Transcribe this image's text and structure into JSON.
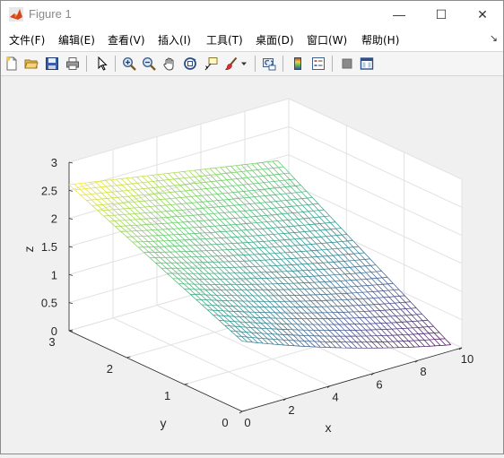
{
  "window": {
    "title": "Figure 1",
    "controls": {
      "minimize": "—",
      "maximize": "☐",
      "close": "✕"
    }
  },
  "menubar": {
    "items": [
      "文件(F)",
      "编辑(E)",
      "查看(V)",
      "插入(I)",
      "工具(T)",
      "桌面(D)",
      "窗口(W)",
      "帮助(H)"
    ],
    "overflow_icon": "arrow-icon"
  },
  "toolbar": {
    "buttons": [
      {
        "name": "new-figure-icon"
      },
      {
        "name": "open-file-icon"
      },
      {
        "name": "save-icon"
      },
      {
        "name": "print-icon"
      },
      {
        "name": "pointer-icon"
      },
      {
        "name": "zoom-in-icon"
      },
      {
        "name": "zoom-out-icon"
      },
      {
        "name": "pan-hand-icon"
      },
      {
        "name": "rotate-3d-icon"
      },
      {
        "name": "data-cursor-icon"
      },
      {
        "name": "brush-icon"
      },
      {
        "name": "link-plot-icon"
      },
      {
        "name": "colorbar-icon"
      },
      {
        "name": "legend-icon"
      },
      {
        "name": "hide-plot-tools-icon"
      },
      {
        "name": "show-plot-tools-icon"
      }
    ]
  },
  "chart_data": {
    "type": "surface-mesh",
    "title": "",
    "xlabel": "x",
    "ylabel": "y",
    "zlabel": "z",
    "xlim": [
      0,
      10
    ],
    "ylim": [
      0,
      3
    ],
    "zlim": [
      0,
      3
    ],
    "xticks": [
      "0",
      "2",
      "4",
      "6",
      "8",
      "10"
    ],
    "yticks": [
      "0",
      "1",
      "2",
      "3"
    ],
    "zticks": [
      "0",
      "0.5",
      "1",
      "1.5",
      "2",
      "2.5",
      "3"
    ],
    "x_range": [
      0,
      9.5
    ],
    "y_range": [
      0,
      3
    ],
    "mesh_x_count": 40,
    "mesh_y_count": 30,
    "surface_corners": [
      {
        "x": 0,
        "y": 0,
        "z": 1.25
      },
      {
        "x": 9.5,
        "y": 0,
        "z": 0.11
      },
      {
        "x": 0,
        "y": 3,
        "z": 2.6
      },
      {
        "x": 9.5,
        "y": 3,
        "z": 1.95
      }
    ],
    "colormap": [
      "#440154",
      "#3b528b",
      "#21918c",
      "#5ec962",
      "#fde725"
    ],
    "grid": true
  }
}
